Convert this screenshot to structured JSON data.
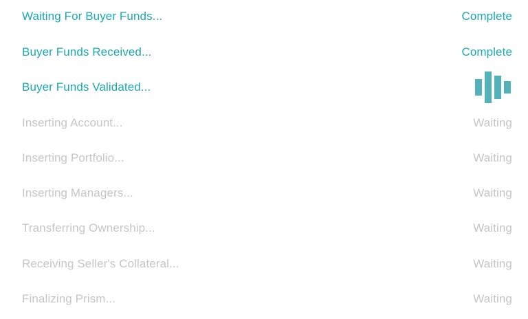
{
  "steps": [
    {
      "label": "Waiting For Buyer Funds...",
      "status": "Complete",
      "state": "complete"
    },
    {
      "label": "Buyer Funds Received...",
      "status": "Complete",
      "state": "complete"
    },
    {
      "label": "Buyer Funds Validated...",
      "status": "",
      "state": "in-progress",
      "indicator": "loading-bars-icon"
    },
    {
      "label": "Inserting Account...",
      "status": "Waiting",
      "state": "waiting"
    },
    {
      "label": "Inserting Portfolio...",
      "status": "Waiting",
      "state": "waiting"
    },
    {
      "label": "Inserting Managers...",
      "status": "Waiting",
      "state": "waiting"
    },
    {
      "label": "Transferring Ownership...",
      "status": "Waiting",
      "state": "waiting"
    },
    {
      "label": "Receiving Seller's Collateral...",
      "status": "Waiting",
      "state": "waiting"
    },
    {
      "label": "Finalizing Prism...",
      "status": "Waiting",
      "state": "waiting"
    }
  ],
  "colors": {
    "accent": "#1aa9b5",
    "loader": "#53b1ba",
    "waiting": "#c6c6c6",
    "background": "#ffffff"
  }
}
